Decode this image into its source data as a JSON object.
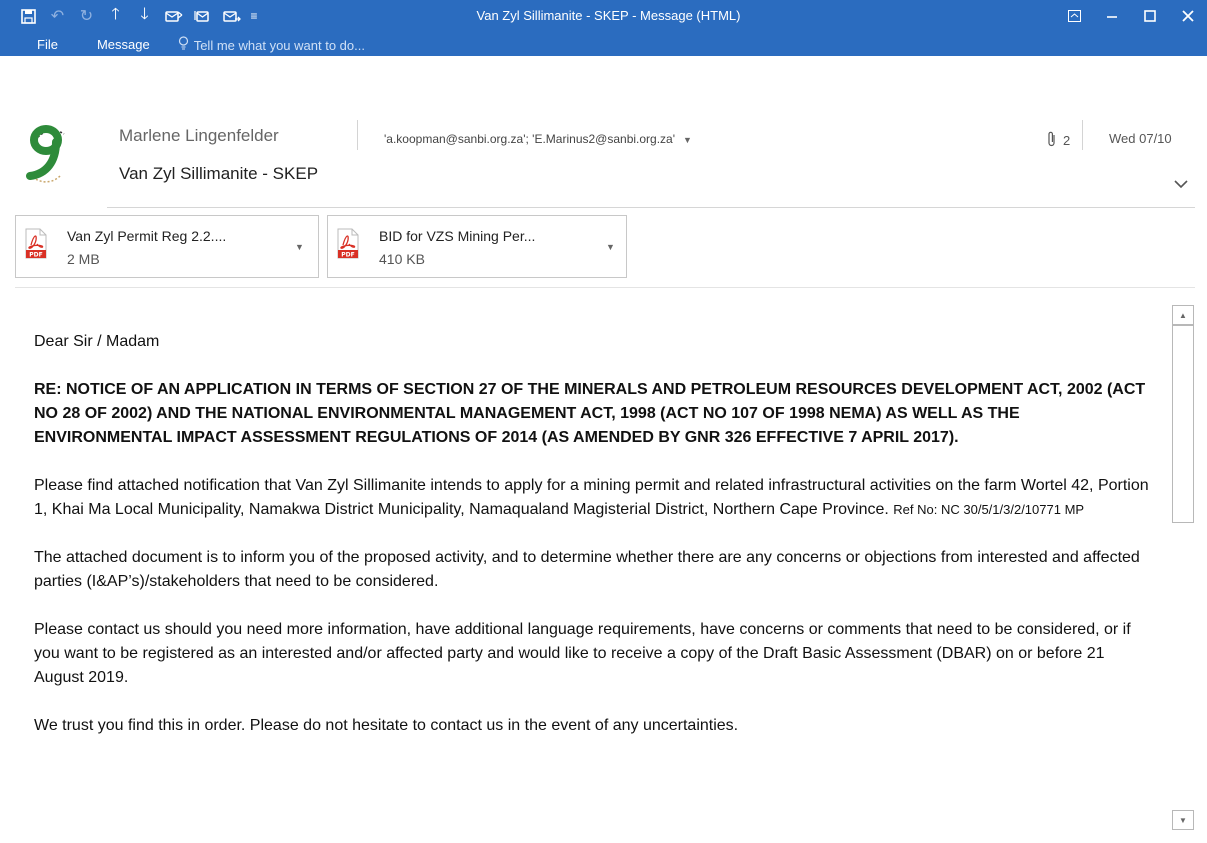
{
  "window": {
    "title": "Van Zyl Sillimanite - SKEP - Message (HTML)"
  },
  "ribbon": {
    "tab_file": "File",
    "tab_message": "Message",
    "tell_me": "Tell me what you want to do..."
  },
  "message": {
    "sender": "Marlene Lingenfelder",
    "recipients": "'a.koopman@sanbi.org.za'; 'E.Marinus2@sanbi.org.za'",
    "attachment_count": "2",
    "date": "Wed 07/10",
    "subject": "Van Zyl Sillimanite - SKEP"
  },
  "attachments": [
    {
      "name": "Van Zyl Permit Reg 2.2....",
      "size": "2 MB"
    },
    {
      "name": "BID for VZS Mining Per...",
      "size": "410 KB"
    }
  ],
  "body": {
    "greeting": "Dear Sir / Madam",
    "notice": "RE: NOTICE OF AN APPLICATION IN TERMS OF SECTION 27 OF THE MINERALS AND PETROLEUM RESOURCES DEVELOPMENT ACT, 2002 (ACT NO 28 OF 2002) AND THE NATIONAL ENVIRONMENTAL MANAGEMENT ACT, 1998 (ACT NO 107 OF 1998 NEMA) AS WELL AS THE ENVIRONMENTAL IMPACT ASSESSMENT REGULATIONS OF 2014 (AS AMENDED BY GNR 326 EFFECTIVE 7 APRIL 2017).",
    "para1": "Please find attached notification that Van Zyl Sillimanite intends to apply for a mining permit and related infrastructural activities on the farm Wortel 42, Portion 1, Khai Ma Local Municipality, Namakwa District Municipality, Namaqualand Magisterial District, Northern Cape Province.",
    "para1_ref": "Ref No: NC 30/5/1/3/2/10771 MP",
    "para2": "The attached document is to inform you of the proposed activity, and to determine whether there are any concerns or objections from interested and affected parties (I&AP’s)/stakeholders that need to be considered.",
    "para3": "Please contact us should you need more information, have additional language requirements, have concerns or comments that need to be considered, or if you want to be registered as an interested and/or affected party and would like to receive a copy of the Draft Basic Assessment (DBAR) on or before 21 August 2019.",
    "para4": "We trust you find this in order.  Please do not hesitate to contact us in the event of any uncertainties."
  },
  "colors": {
    "titlebar": "#2b6cbf",
    "logo_green": "#2e8b3a",
    "pdf_red": "#d93025"
  }
}
